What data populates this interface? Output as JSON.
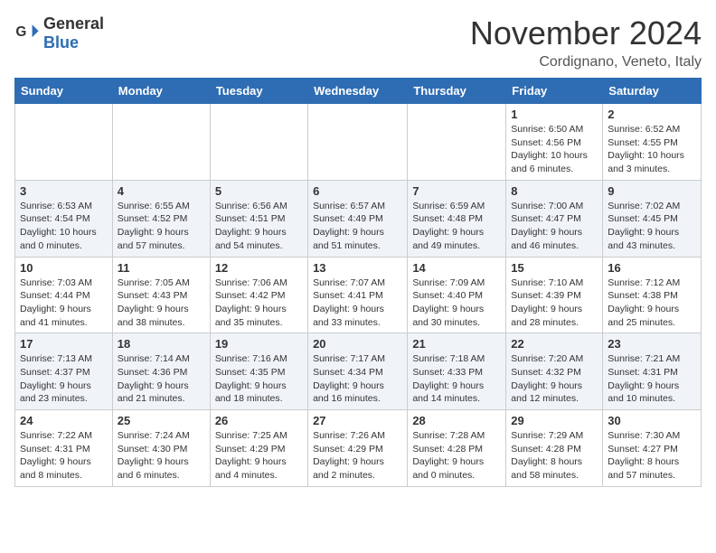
{
  "header": {
    "logo_general": "General",
    "logo_blue": "Blue",
    "month_title": "November 2024",
    "location": "Cordignano, Veneto, Italy"
  },
  "weekdays": [
    "Sunday",
    "Monday",
    "Tuesday",
    "Wednesday",
    "Thursday",
    "Friday",
    "Saturday"
  ],
  "weeks": [
    [
      {
        "day": "",
        "info": ""
      },
      {
        "day": "",
        "info": ""
      },
      {
        "day": "",
        "info": ""
      },
      {
        "day": "",
        "info": ""
      },
      {
        "day": "",
        "info": ""
      },
      {
        "day": "1",
        "info": "Sunrise: 6:50 AM\nSunset: 4:56 PM\nDaylight: 10 hours\nand 6 minutes."
      },
      {
        "day": "2",
        "info": "Sunrise: 6:52 AM\nSunset: 4:55 PM\nDaylight: 10 hours\nand 3 minutes."
      }
    ],
    [
      {
        "day": "3",
        "info": "Sunrise: 6:53 AM\nSunset: 4:54 PM\nDaylight: 10 hours\nand 0 minutes."
      },
      {
        "day": "4",
        "info": "Sunrise: 6:55 AM\nSunset: 4:52 PM\nDaylight: 9 hours\nand 57 minutes."
      },
      {
        "day": "5",
        "info": "Sunrise: 6:56 AM\nSunset: 4:51 PM\nDaylight: 9 hours\nand 54 minutes."
      },
      {
        "day": "6",
        "info": "Sunrise: 6:57 AM\nSunset: 4:49 PM\nDaylight: 9 hours\nand 51 minutes."
      },
      {
        "day": "7",
        "info": "Sunrise: 6:59 AM\nSunset: 4:48 PM\nDaylight: 9 hours\nand 49 minutes."
      },
      {
        "day": "8",
        "info": "Sunrise: 7:00 AM\nSunset: 4:47 PM\nDaylight: 9 hours\nand 46 minutes."
      },
      {
        "day": "9",
        "info": "Sunrise: 7:02 AM\nSunset: 4:45 PM\nDaylight: 9 hours\nand 43 minutes."
      }
    ],
    [
      {
        "day": "10",
        "info": "Sunrise: 7:03 AM\nSunset: 4:44 PM\nDaylight: 9 hours\nand 41 minutes."
      },
      {
        "day": "11",
        "info": "Sunrise: 7:05 AM\nSunset: 4:43 PM\nDaylight: 9 hours\nand 38 minutes."
      },
      {
        "day": "12",
        "info": "Sunrise: 7:06 AM\nSunset: 4:42 PM\nDaylight: 9 hours\nand 35 minutes."
      },
      {
        "day": "13",
        "info": "Sunrise: 7:07 AM\nSunset: 4:41 PM\nDaylight: 9 hours\nand 33 minutes."
      },
      {
        "day": "14",
        "info": "Sunrise: 7:09 AM\nSunset: 4:40 PM\nDaylight: 9 hours\nand 30 minutes."
      },
      {
        "day": "15",
        "info": "Sunrise: 7:10 AM\nSunset: 4:39 PM\nDaylight: 9 hours\nand 28 minutes."
      },
      {
        "day": "16",
        "info": "Sunrise: 7:12 AM\nSunset: 4:38 PM\nDaylight: 9 hours\nand 25 minutes."
      }
    ],
    [
      {
        "day": "17",
        "info": "Sunrise: 7:13 AM\nSunset: 4:37 PM\nDaylight: 9 hours\nand 23 minutes."
      },
      {
        "day": "18",
        "info": "Sunrise: 7:14 AM\nSunset: 4:36 PM\nDaylight: 9 hours\nand 21 minutes."
      },
      {
        "day": "19",
        "info": "Sunrise: 7:16 AM\nSunset: 4:35 PM\nDaylight: 9 hours\nand 18 minutes."
      },
      {
        "day": "20",
        "info": "Sunrise: 7:17 AM\nSunset: 4:34 PM\nDaylight: 9 hours\nand 16 minutes."
      },
      {
        "day": "21",
        "info": "Sunrise: 7:18 AM\nSunset: 4:33 PM\nDaylight: 9 hours\nand 14 minutes."
      },
      {
        "day": "22",
        "info": "Sunrise: 7:20 AM\nSunset: 4:32 PM\nDaylight: 9 hours\nand 12 minutes."
      },
      {
        "day": "23",
        "info": "Sunrise: 7:21 AM\nSunset: 4:31 PM\nDaylight: 9 hours\nand 10 minutes."
      }
    ],
    [
      {
        "day": "24",
        "info": "Sunrise: 7:22 AM\nSunset: 4:31 PM\nDaylight: 9 hours\nand 8 minutes."
      },
      {
        "day": "25",
        "info": "Sunrise: 7:24 AM\nSunset: 4:30 PM\nDaylight: 9 hours\nand 6 minutes."
      },
      {
        "day": "26",
        "info": "Sunrise: 7:25 AM\nSunset: 4:29 PM\nDaylight: 9 hours\nand 4 minutes."
      },
      {
        "day": "27",
        "info": "Sunrise: 7:26 AM\nSunset: 4:29 PM\nDaylight: 9 hours\nand 2 minutes."
      },
      {
        "day": "28",
        "info": "Sunrise: 7:28 AM\nSunset: 4:28 PM\nDaylight: 9 hours\nand 0 minutes."
      },
      {
        "day": "29",
        "info": "Sunrise: 7:29 AM\nSunset: 4:28 PM\nDaylight: 8 hours\nand 58 minutes."
      },
      {
        "day": "30",
        "info": "Sunrise: 7:30 AM\nSunset: 4:27 PM\nDaylight: 8 hours\nand 57 minutes."
      }
    ]
  ]
}
